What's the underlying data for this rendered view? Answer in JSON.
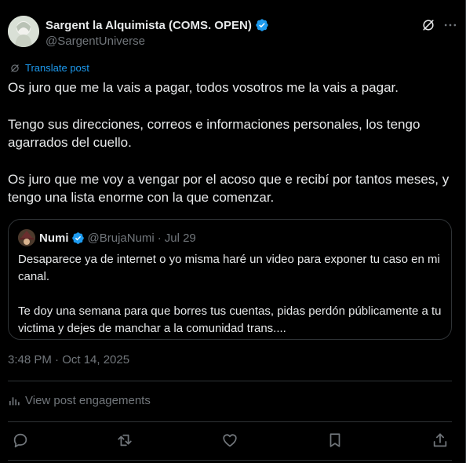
{
  "author": {
    "display_name": "Sargent la Alquimista (COMS. OPEN)",
    "handle": "@SargentUniverse",
    "verified": true
  },
  "translate_label": "Translate post",
  "post_paragraphs": [
    "Os juro que me la vais a pagar, todos vosotros me la vais a pagar.",
    "Tengo sus direcciones, correos e informaciones personales, los tengo agarrados del cuello.",
    "Os juro que me voy a vengar por el acoso que e recibí por tantos meses, y tengo una lista enorme con la que comenzar."
  ],
  "quote": {
    "display_name": "Numi",
    "handle": "@BrujaNumi",
    "separator": "·",
    "date": "Jul 29",
    "paragraphs": [
      "Desaparece ya de internet o yo misma haré un video para exponer tu caso en mi canal.",
      "Te doy una semana para que borres tus cuentas, pidas perdón públicamente a tu victima y dejes de manchar a la comunidad trans...."
    ]
  },
  "timestamp": "3:48 PM · Oct 14, 2025",
  "engagements_label": "View post engagements",
  "colors": {
    "background": "#000000",
    "text": "#e7e9ea",
    "muted": "#71767b",
    "accent": "#1d9bf0",
    "border": "#2f3336"
  },
  "icons": [
    "grok-icon",
    "more-icon",
    "translate-icon",
    "verified-badge-icon",
    "analytics-icon",
    "reply-icon",
    "repost-icon",
    "like-icon",
    "bookmark-icon",
    "share-icon"
  ]
}
